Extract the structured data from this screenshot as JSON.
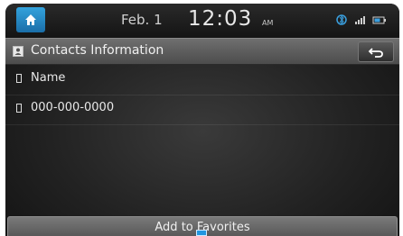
{
  "status_bar": {
    "date": "Feb.  1",
    "time": "12:03",
    "ampm": "AM",
    "icons": [
      "bluetooth-icon",
      "signal-icon",
      "battery-icon"
    ]
  },
  "header": {
    "title": "Contacts Information",
    "back_icon": "back-arrow-icon"
  },
  "contact": {
    "name": "Name",
    "phone": "000-000-0000"
  },
  "actions": {
    "add_to_favorites": "Add to Favorites"
  },
  "colors": {
    "home_accent": "#1a8fd0",
    "title_bar": "#5c5c5c",
    "background": "#222222"
  }
}
